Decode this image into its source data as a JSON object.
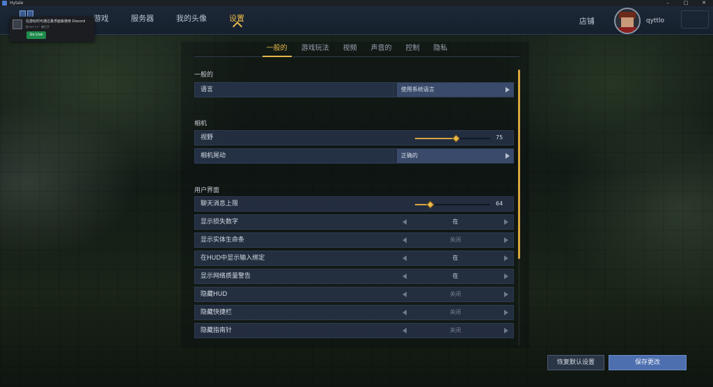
{
  "window": {
    "title": "Hytale",
    "minimize": "–",
    "maximize": "□",
    "close": "✕"
  },
  "nav": {
    "items": [
      {
        "label": "游戏"
      },
      {
        "label": "服务器"
      },
      {
        "label": "我的头像"
      },
      {
        "label": "设置",
        "active": true
      }
    ],
    "shop": "店铺",
    "username": "qyttlo"
  },
  "toast": {
    "text": "在游玩时可通过悬浮面板使用 Discord",
    "sub": "按  ⊞+⇧+`  键打开",
    "button": "Go Live"
  },
  "tabs": [
    {
      "label": "一般的",
      "active": true
    },
    {
      "label": "游戏玩法"
    },
    {
      "label": "视频"
    },
    {
      "label": "声音的"
    },
    {
      "label": "控制"
    },
    {
      "label": "隐私"
    }
  ],
  "sections": {
    "general": "一般的",
    "camera": "相机",
    "ui": "用户界面"
  },
  "settings": {
    "language": {
      "label": "语言",
      "value": "使用系统语言"
    },
    "fov": {
      "label": "视野",
      "value": "75",
      "fraction": 0.55
    },
    "camera_head": {
      "label": "相机晃动",
      "value": "正确的"
    },
    "chat_limit": {
      "label": "聊天消息上限",
      "value": "64",
      "fraction": 0.2
    },
    "toggles": [
      {
        "label": "显示损失数字",
        "value": "在"
      },
      {
        "label": "显示实体生命条",
        "value": "关闭"
      },
      {
        "label": "在HUD中显示输入绑定",
        "value": "在"
      },
      {
        "label": "显示网络质量警告",
        "value": "在"
      },
      {
        "label": "隐藏HUD",
        "value": "关闭"
      },
      {
        "label": "隐藏快捷栏",
        "value": "关闭"
      },
      {
        "label": "隐藏指南针",
        "value": "关闭"
      }
    ]
  },
  "buttons": {
    "reset": "恢复默认设置",
    "save": "保存更改"
  },
  "colors": {
    "accent": "#e8b94a",
    "row": "#253145",
    "save": "#4d6fb0"
  }
}
